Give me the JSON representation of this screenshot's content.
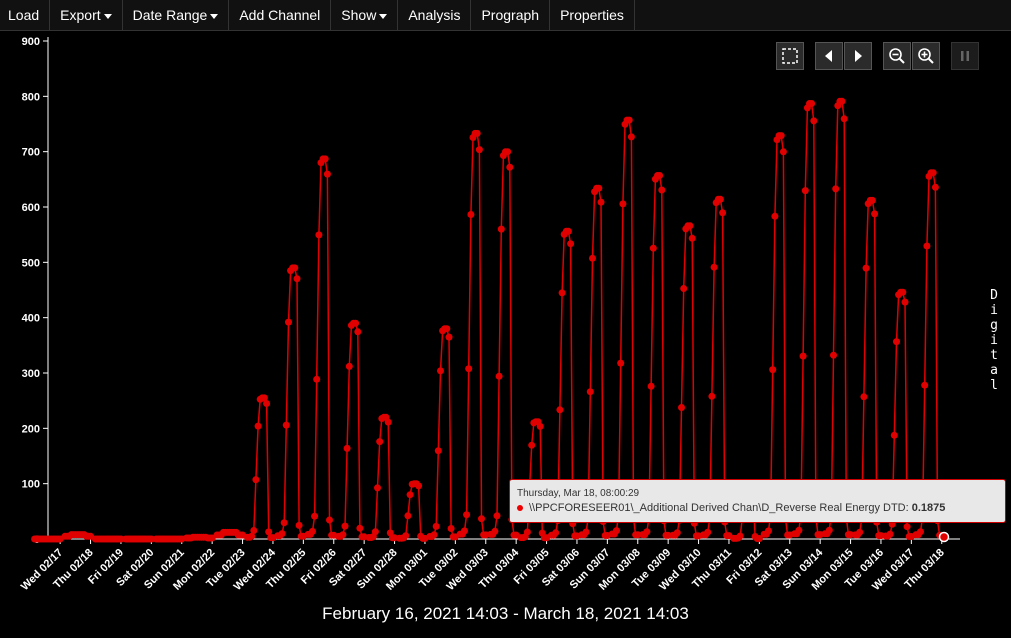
{
  "menu": {
    "load": "Load",
    "export": "Export",
    "date_range": "Date Range",
    "add_channel": "Add Channel",
    "show": "Show",
    "analysis": "Analysis",
    "prograph": "Prograph",
    "properties": "Properties"
  },
  "toolbar": {
    "icons": [
      "select-region-icon",
      "arrow-left-icon",
      "arrow-right-icon",
      "zoom-out-icon",
      "zoom-in-icon",
      "pause-icon"
    ]
  },
  "side_label": "Digital",
  "date_range_label": "February 16, 2021 14:03 - March 18, 2021 14:03",
  "tooltip": {
    "time": "Thursday, Mar 18, 08:00:29",
    "series": "\\\\PPCFORESEER01\\_Additional Derived Chan\\D_Reverse Real Energy DTD:",
    "value": "0.1875"
  },
  "colors": {
    "series": "#e00000",
    "background": "#000000",
    "axis": "#ffffff"
  },
  "chart_data": {
    "type": "line",
    "ylim": [
      0,
      900
    ],
    "y_ticks": [
      0,
      100,
      200,
      300,
      400,
      500,
      600,
      700,
      800,
      900
    ],
    "x_range_days": [
      0,
      30
    ],
    "categories": [
      "Wed 02/17",
      "Thu 02/18",
      "Fri 02/19",
      "Sat 02/20",
      "Sun 02/21",
      "Mon 02/22",
      "Tue 02/23",
      "Wed 02/24",
      "Thu 02/25",
      "Fri 02/26",
      "Sat 02/27",
      "Sun 02/28",
      "Mon 03/01",
      "Tue 03/02",
      "Wed 03/03",
      "Thu 03/04",
      "Fri 03/05",
      "Sat 03/06",
      "Sun 03/07",
      "Mon 03/08",
      "Tue 03/09",
      "Wed 03/10",
      "Thu 03/11",
      "Fri 03/12",
      "Sat 03/13",
      "Sun 03/14",
      "Mon 03/15",
      "Tue 03/16",
      "Wed 03/17",
      "Thu 03/18"
    ],
    "series": [
      {
        "daily_peaks": [
          0,
          8,
          0,
          0,
          0,
          3,
          12,
          255,
          490,
          687,
          390,
          220,
          100,
          380,
          733,
          700,
          212,
          556,
          634,
          757,
          657,
          566,
          614,
          90,
          729,
          787,
          791,
          612,
          446,
          662
        ]
      }
    ],
    "grid": false
  }
}
